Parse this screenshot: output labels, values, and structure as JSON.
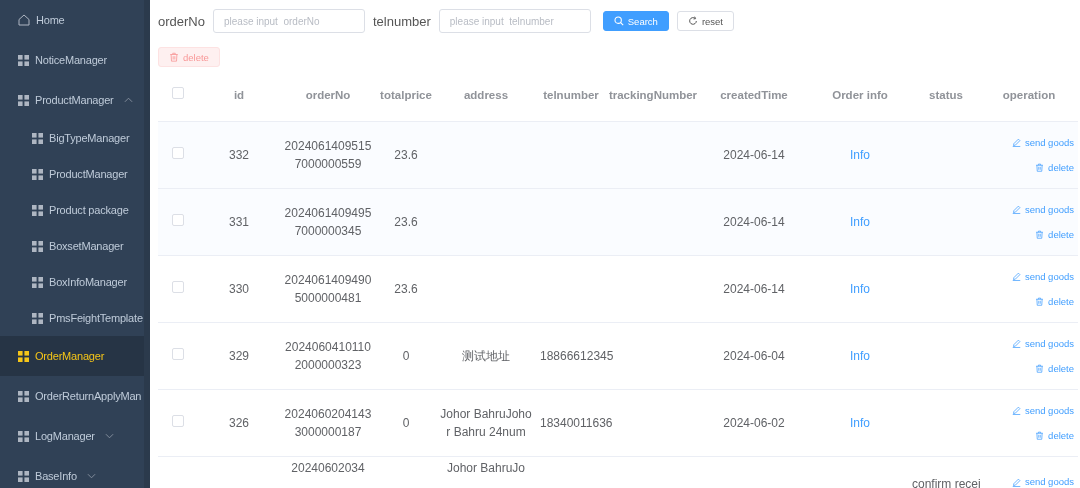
{
  "sidebar": {
    "items": [
      {
        "label": "Home",
        "kind": "link",
        "selected": false
      },
      {
        "label": "NoticeManager",
        "kind": "link",
        "selected": false
      },
      {
        "label": "ProductManager",
        "kind": "submenu",
        "expanded": true,
        "selected": false,
        "children": [
          {
            "label": "BigTypeManager",
            "selected": false
          },
          {
            "label": "ProductManager",
            "selected": false
          },
          {
            "label": "Product package",
            "selected": false
          },
          {
            "label": "BoxsetManager",
            "selected": false
          },
          {
            "label": "BoxInfoManager",
            "selected": false
          },
          {
            "label": "PmsFeightTemplate",
            "selected": false
          }
        ]
      },
      {
        "label": "OrderManager",
        "kind": "link",
        "selected": true
      },
      {
        "label": "OrderReturnApplyMan",
        "kind": "link",
        "selected": false
      },
      {
        "label": "LogManager",
        "kind": "submenu",
        "expanded": false,
        "selected": false
      },
      {
        "label": "BaseInfo",
        "kind": "submenu",
        "expanded": false,
        "selected": false
      }
    ]
  },
  "search": {
    "fields": [
      {
        "label": "orderNo",
        "placeholder": "please input  orderNo"
      },
      {
        "label": "telnumber",
        "placeholder": "please input  telnumber"
      }
    ],
    "search_button": "Search",
    "reset_button": "reset"
  },
  "delete_button": {
    "label": "delete",
    "disabled": true
  },
  "table": {
    "header_checked": false,
    "columns": [
      "id",
      "orderNo",
      "totalprice",
      "address",
      "telnumber",
      "trackingNumber",
      "createdTime",
      "Order info",
      "status",
      "operation"
    ],
    "rows": [
      {
        "checked": false,
        "id": "332",
        "orderNo": "20240614095157000000559",
        "totalprice": "23.6",
        "address": "",
        "telnumber": "",
        "createdTime": "2024-06-14",
        "info": "Info",
        "status": "",
        "actions": [
          {
            "kind": "edit",
            "label": "send goods"
          },
          {
            "kind": "delete",
            "label": "delete"
          }
        ]
      },
      {
        "checked": false,
        "id": "331",
        "orderNo": "20240614094957000000345",
        "totalprice": "23.6",
        "address": "",
        "telnumber": "",
        "createdTime": "2024-06-14",
        "info": "Info",
        "status": "",
        "actions": [
          {
            "kind": "edit",
            "label": "send goods"
          },
          {
            "kind": "delete",
            "label": "delete"
          }
        ]
      },
      {
        "checked": false,
        "id": "330",
        "orderNo": "20240614094905000000481",
        "totalprice": "23.6",
        "address": "",
        "telnumber": "",
        "createdTime": "2024-06-14",
        "info": "Info",
        "status": "",
        "actions": [
          {
            "kind": "edit",
            "label": "send goods"
          },
          {
            "kind": "delete",
            "label": "delete"
          }
        ]
      },
      {
        "checked": false,
        "id": "329",
        "orderNo": "20240604101102000000323",
        "totalprice": "0",
        "address": "测试地址",
        "telnumber": "18866612345",
        "createdTime": "2024-06-04",
        "info": "Info",
        "status": "",
        "actions": [
          {
            "kind": "edit",
            "label": "send goods"
          },
          {
            "kind": "delete",
            "label": "delete"
          }
        ]
      },
      {
        "checked": false,
        "id": "326",
        "orderNo": "20240602041433000000187",
        "totalprice": "0",
        "address": "Johor BahruJohor Bahru 24num",
        "telnumber": "18340011636",
        "createdTime": "2024-06-02",
        "info": "Info",
        "status": "",
        "actions": [
          {
            "kind": "edit",
            "label": "send goods"
          },
          {
            "kind": "delete",
            "label": "delete"
          }
        ]
      },
      {
        "orderNo": "20240602034",
        "address": "Johor BahruJo",
        "status": "confirm recei",
        "actions": [
          {
            "kind": "edit",
            "label": "send goods"
          }
        ]
      }
    ]
  }
}
